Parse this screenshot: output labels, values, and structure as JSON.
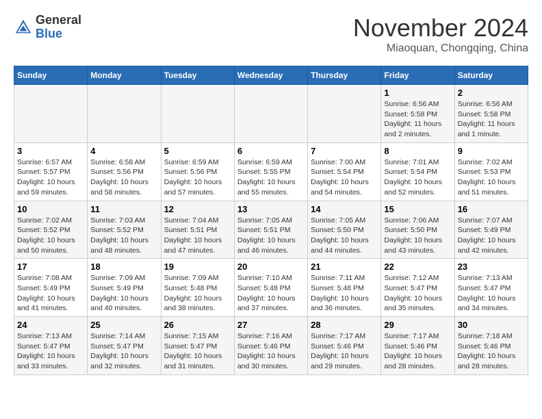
{
  "header": {
    "logo_general": "General",
    "logo_blue": "Blue",
    "month_title": "November 2024",
    "location": "Miaoquan, Chongqing, China"
  },
  "weekdays": [
    "Sunday",
    "Monday",
    "Tuesday",
    "Wednesday",
    "Thursday",
    "Friday",
    "Saturday"
  ],
  "weeks": [
    [
      {
        "day": "",
        "info": ""
      },
      {
        "day": "",
        "info": ""
      },
      {
        "day": "",
        "info": ""
      },
      {
        "day": "",
        "info": ""
      },
      {
        "day": "",
        "info": ""
      },
      {
        "day": "1",
        "info": "Sunrise: 6:56 AM\nSunset: 5:58 PM\nDaylight: 11 hours and 2 minutes."
      },
      {
        "day": "2",
        "info": "Sunrise: 6:56 AM\nSunset: 5:58 PM\nDaylight: 11 hours and 1 minute."
      }
    ],
    [
      {
        "day": "3",
        "info": "Sunrise: 6:57 AM\nSunset: 5:57 PM\nDaylight: 10 hours and 59 minutes."
      },
      {
        "day": "4",
        "info": "Sunrise: 6:58 AM\nSunset: 5:56 PM\nDaylight: 10 hours and 58 minutes."
      },
      {
        "day": "5",
        "info": "Sunrise: 6:59 AM\nSunset: 5:56 PM\nDaylight: 10 hours and 57 minutes."
      },
      {
        "day": "6",
        "info": "Sunrise: 6:59 AM\nSunset: 5:55 PM\nDaylight: 10 hours and 55 minutes."
      },
      {
        "day": "7",
        "info": "Sunrise: 7:00 AM\nSunset: 5:54 PM\nDaylight: 10 hours and 54 minutes."
      },
      {
        "day": "8",
        "info": "Sunrise: 7:01 AM\nSunset: 5:54 PM\nDaylight: 10 hours and 52 minutes."
      },
      {
        "day": "9",
        "info": "Sunrise: 7:02 AM\nSunset: 5:53 PM\nDaylight: 10 hours and 51 minutes."
      }
    ],
    [
      {
        "day": "10",
        "info": "Sunrise: 7:02 AM\nSunset: 5:52 PM\nDaylight: 10 hours and 50 minutes."
      },
      {
        "day": "11",
        "info": "Sunrise: 7:03 AM\nSunset: 5:52 PM\nDaylight: 10 hours and 48 minutes."
      },
      {
        "day": "12",
        "info": "Sunrise: 7:04 AM\nSunset: 5:51 PM\nDaylight: 10 hours and 47 minutes."
      },
      {
        "day": "13",
        "info": "Sunrise: 7:05 AM\nSunset: 5:51 PM\nDaylight: 10 hours and 46 minutes."
      },
      {
        "day": "14",
        "info": "Sunrise: 7:05 AM\nSunset: 5:50 PM\nDaylight: 10 hours and 44 minutes."
      },
      {
        "day": "15",
        "info": "Sunrise: 7:06 AM\nSunset: 5:50 PM\nDaylight: 10 hours and 43 minutes."
      },
      {
        "day": "16",
        "info": "Sunrise: 7:07 AM\nSunset: 5:49 PM\nDaylight: 10 hours and 42 minutes."
      }
    ],
    [
      {
        "day": "17",
        "info": "Sunrise: 7:08 AM\nSunset: 5:49 PM\nDaylight: 10 hours and 41 minutes."
      },
      {
        "day": "18",
        "info": "Sunrise: 7:09 AM\nSunset: 5:49 PM\nDaylight: 10 hours and 40 minutes."
      },
      {
        "day": "19",
        "info": "Sunrise: 7:09 AM\nSunset: 5:48 PM\nDaylight: 10 hours and 38 minutes."
      },
      {
        "day": "20",
        "info": "Sunrise: 7:10 AM\nSunset: 5:48 PM\nDaylight: 10 hours and 37 minutes."
      },
      {
        "day": "21",
        "info": "Sunrise: 7:11 AM\nSunset: 5:48 PM\nDaylight: 10 hours and 36 minutes."
      },
      {
        "day": "22",
        "info": "Sunrise: 7:12 AM\nSunset: 5:47 PM\nDaylight: 10 hours and 35 minutes."
      },
      {
        "day": "23",
        "info": "Sunrise: 7:13 AM\nSunset: 5:47 PM\nDaylight: 10 hours and 34 minutes."
      }
    ],
    [
      {
        "day": "24",
        "info": "Sunrise: 7:13 AM\nSunset: 5:47 PM\nDaylight: 10 hours and 33 minutes."
      },
      {
        "day": "25",
        "info": "Sunrise: 7:14 AM\nSunset: 5:47 PM\nDaylight: 10 hours and 32 minutes."
      },
      {
        "day": "26",
        "info": "Sunrise: 7:15 AM\nSunset: 5:47 PM\nDaylight: 10 hours and 31 minutes."
      },
      {
        "day": "27",
        "info": "Sunrise: 7:16 AM\nSunset: 5:46 PM\nDaylight: 10 hours and 30 minutes."
      },
      {
        "day": "28",
        "info": "Sunrise: 7:17 AM\nSunset: 5:46 PM\nDaylight: 10 hours and 29 minutes."
      },
      {
        "day": "29",
        "info": "Sunrise: 7:17 AM\nSunset: 5:46 PM\nDaylight: 10 hours and 28 minutes."
      },
      {
        "day": "30",
        "info": "Sunrise: 7:18 AM\nSunset: 5:46 PM\nDaylight: 10 hours and 28 minutes."
      }
    ]
  ]
}
